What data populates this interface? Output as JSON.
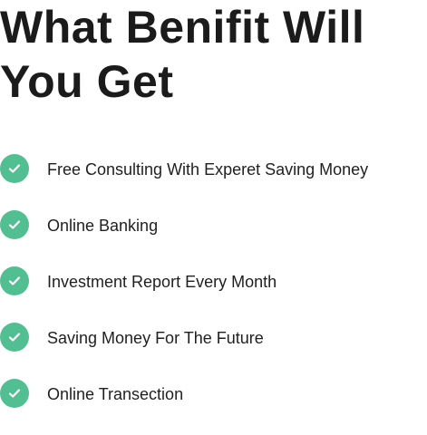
{
  "heading": "What Benifit Will You Get",
  "accent_color": "#52bf93",
  "benefits": [
    {
      "label": "Free Consulting With Experet Saving Money",
      "icon": "check-circle-icon"
    },
    {
      "label": "Online Banking",
      "icon": "check-circle-icon"
    },
    {
      "label": "Investment Report Every Month",
      "icon": "check-circle-icon"
    },
    {
      "label": "Saving Money For The Future",
      "icon": "check-circle-icon"
    },
    {
      "label": "Online Transection",
      "icon": "check-circle-icon"
    }
  ]
}
